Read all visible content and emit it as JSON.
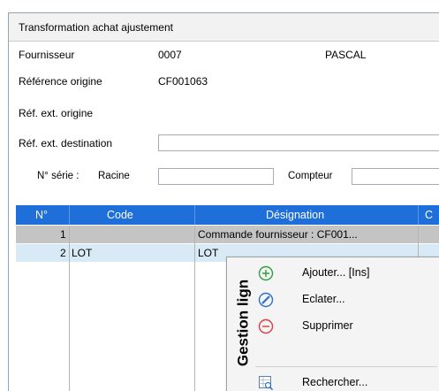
{
  "window": {
    "title": "Transformation achat ajustement"
  },
  "form": {
    "fournisseur_label": "Fournisseur",
    "fournisseur_code": "0007",
    "fournisseur_name": "PASCAL",
    "ref_origine_label": "Référence origine",
    "ref_origine_value": "CF001063",
    "ref_ext_origine_label": "Réf. ext. origine",
    "ref_ext_dest_label": "Réf. ext. destination",
    "ref_ext_dest_value": "",
    "serie_label": "N° série :",
    "racine_label": "Racine",
    "racine_value": "",
    "compteur_label": "Compteur",
    "compteur_value": ""
  },
  "grid": {
    "columns": [
      "N°",
      "Code",
      "Désignation",
      "C"
    ],
    "rows": [
      {
        "num": "1",
        "code": "",
        "designation": "Commande fournisseur : CF001..."
      },
      {
        "num": "2",
        "code": "LOT",
        "designation": "LOT"
      }
    ]
  },
  "context_menu": {
    "title": "Gestion lign",
    "items": [
      {
        "label": "Ajouter... [Ins]",
        "icon": "plus-circle-icon"
      },
      {
        "label": "Eclater...",
        "icon": "slash-circle-icon"
      },
      {
        "label": "Supprimer",
        "icon": "minus-circle-icon"
      },
      {
        "label": "Rechercher...",
        "icon": "search-grid-icon"
      }
    ]
  },
  "colors": {
    "header_blue": "#1e6fd9",
    "add_green": "#2e9e3e",
    "edit_blue": "#2c6fd0",
    "delete_red": "#e0393e"
  }
}
